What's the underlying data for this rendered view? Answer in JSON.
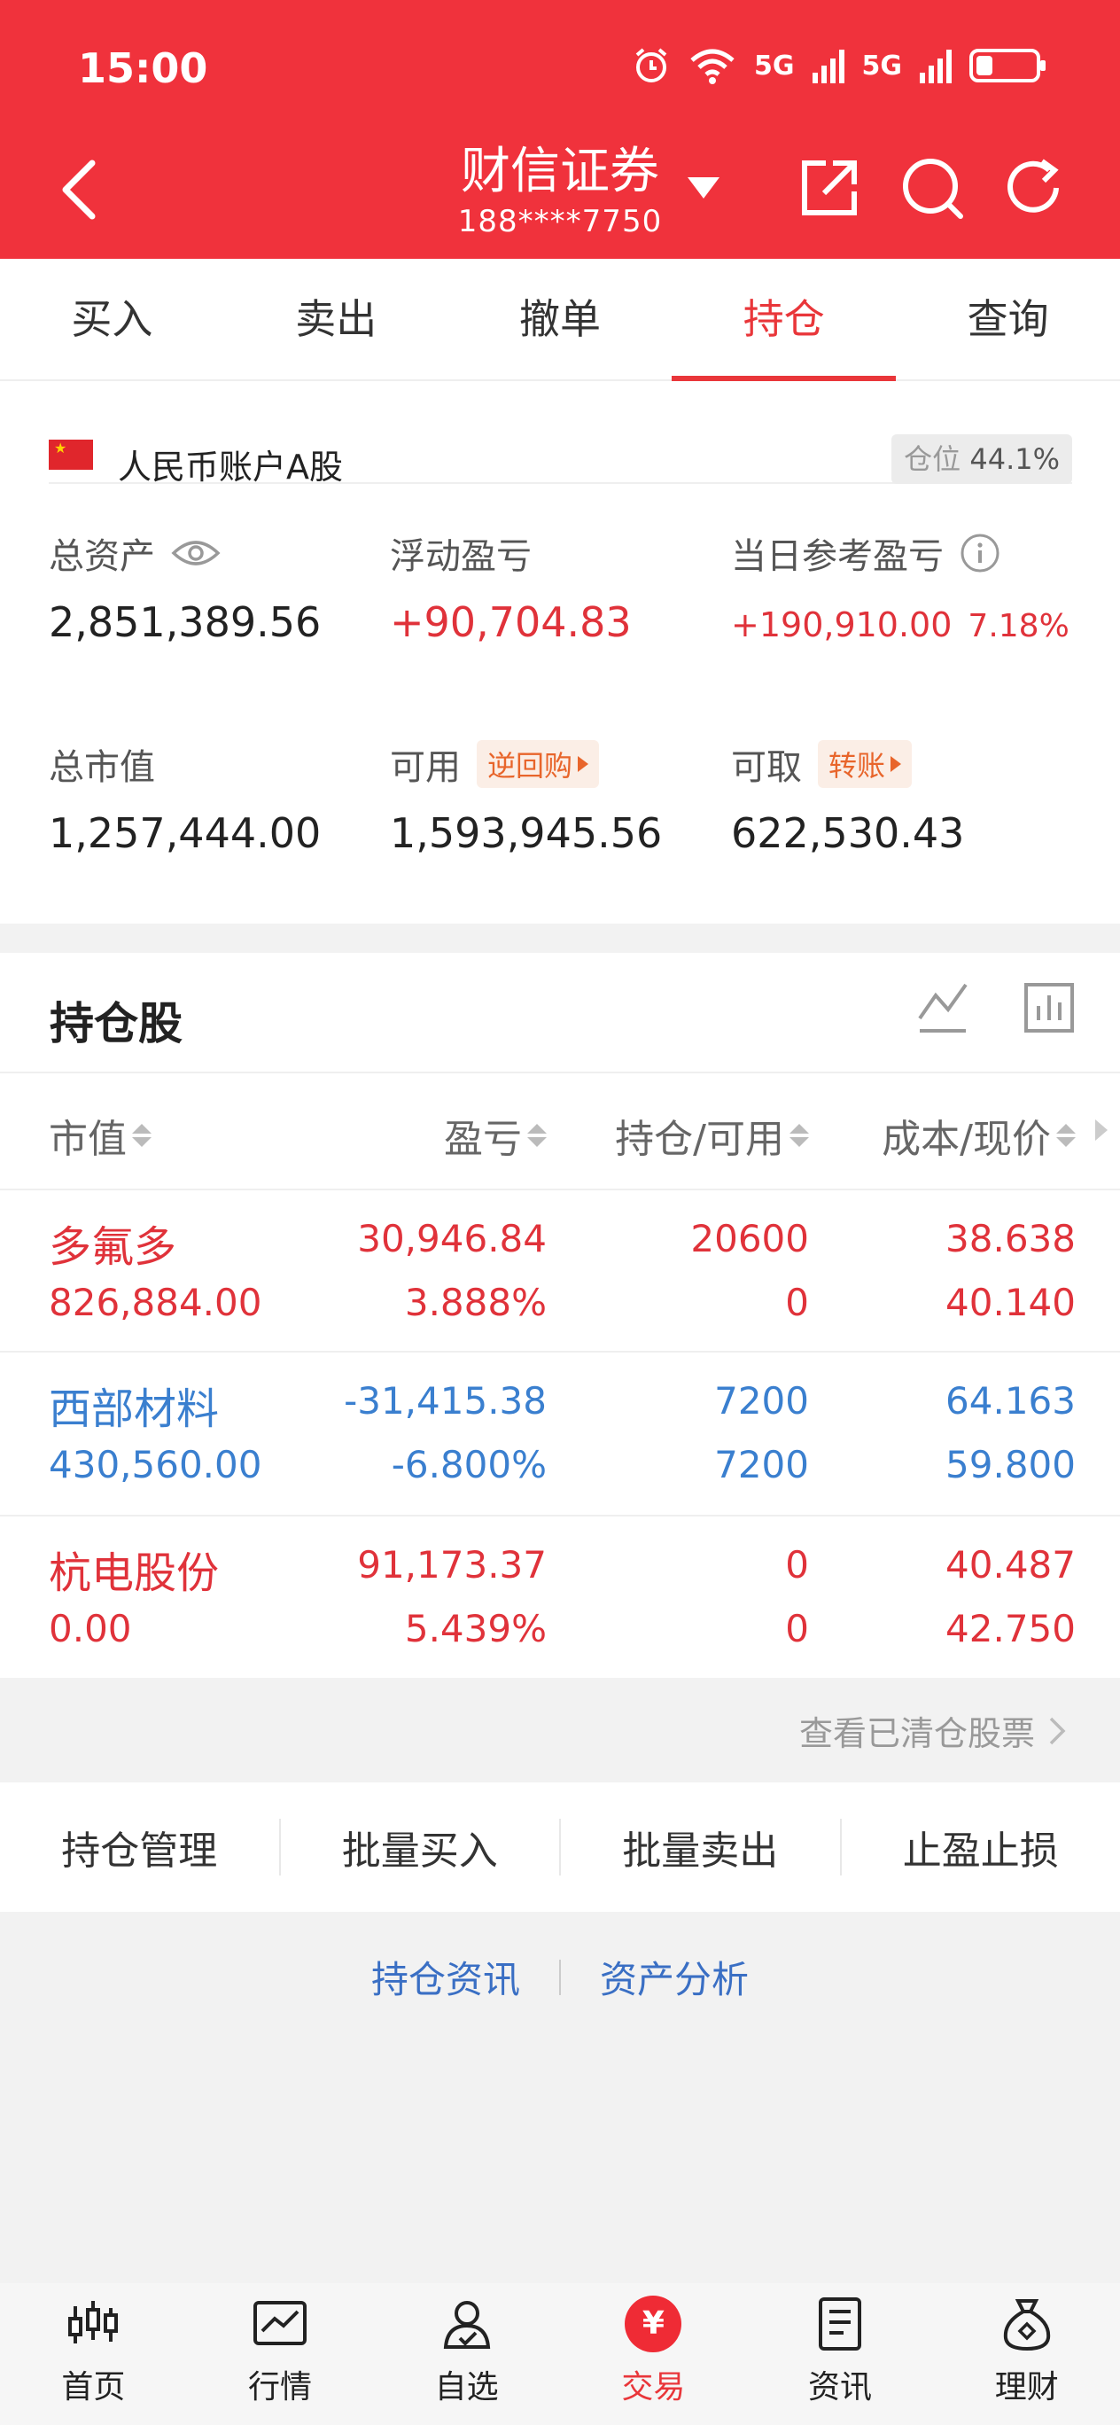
{
  "status_bar": {
    "time": "15:00",
    "network1": "5G",
    "network2": "5G"
  },
  "header": {
    "title": "财信证券",
    "account_masked": "188****7750"
  },
  "tabs": [
    {
      "label": "买入"
    },
    {
      "label": "卖出"
    },
    {
      "label": "撤单"
    },
    {
      "label": "持仓",
      "active": true
    },
    {
      "label": "查询"
    }
  ],
  "account": {
    "name": "人民币账户A股",
    "position_label": "仓位",
    "position_value": "44.1%",
    "total_assets": {
      "label": "总资产",
      "value": "2,851,389.56"
    },
    "floating_pl": {
      "label": "浮动盈亏",
      "value": "+90,704.83"
    },
    "daily_pl": {
      "label": "当日参考盈亏",
      "value": "+190,910.00",
      "pct": "7.18%"
    },
    "market_value": {
      "label": "总市值",
      "value": "1,257,444.00"
    },
    "available": {
      "label": "可用",
      "chip": "逆回购",
      "value": "1,593,945.56"
    },
    "withdrawable": {
      "label": "可取",
      "chip": "转账",
      "value": "622,530.43"
    }
  },
  "positions": {
    "title": "持仓股",
    "columns": [
      "市值",
      "盈亏",
      "持仓/可用",
      "成本/现价"
    ],
    "rows": [
      {
        "name": "多氟多",
        "market_value": "826,884.00",
        "pl": "30,946.84",
        "pl_pct": "3.888%",
        "hold": "20600",
        "avail": "0",
        "cost": "38.638",
        "price": "40.140",
        "color": "#e0323a"
      },
      {
        "name": "西部材料",
        "market_value": "430,560.00",
        "pl": "-31,415.38",
        "pl_pct": "-6.800%",
        "hold": "7200",
        "avail": "7200",
        "cost": "64.163",
        "price": "59.800",
        "color": "#3a7fcf"
      },
      {
        "name": "杭电股份",
        "market_value": "0.00",
        "pl": "91,173.37",
        "pl_pct": "5.439%",
        "hold": "0",
        "avail": "0",
        "cost": "40.487",
        "price": "42.750",
        "color": "#e0323a"
      }
    ],
    "cleared_link": "查看已清仓股票"
  },
  "actions": [
    "持仓管理",
    "批量买入",
    "批量卖出",
    "止盈止损"
  ],
  "links": [
    "持仓资讯",
    "资产分析"
  ],
  "bottom_nav": [
    {
      "label": "首页",
      "icon": "home-candlestick-icon"
    },
    {
      "label": "行情",
      "icon": "market-chart-icon"
    },
    {
      "label": "自选",
      "icon": "watchlist-user-icon"
    },
    {
      "label": "交易",
      "icon": "trade-yuan-icon",
      "glyph": "¥",
      "active": true
    },
    {
      "label": "资讯",
      "icon": "news-document-icon"
    },
    {
      "label": "理财",
      "icon": "wealth-bag-icon"
    }
  ]
}
